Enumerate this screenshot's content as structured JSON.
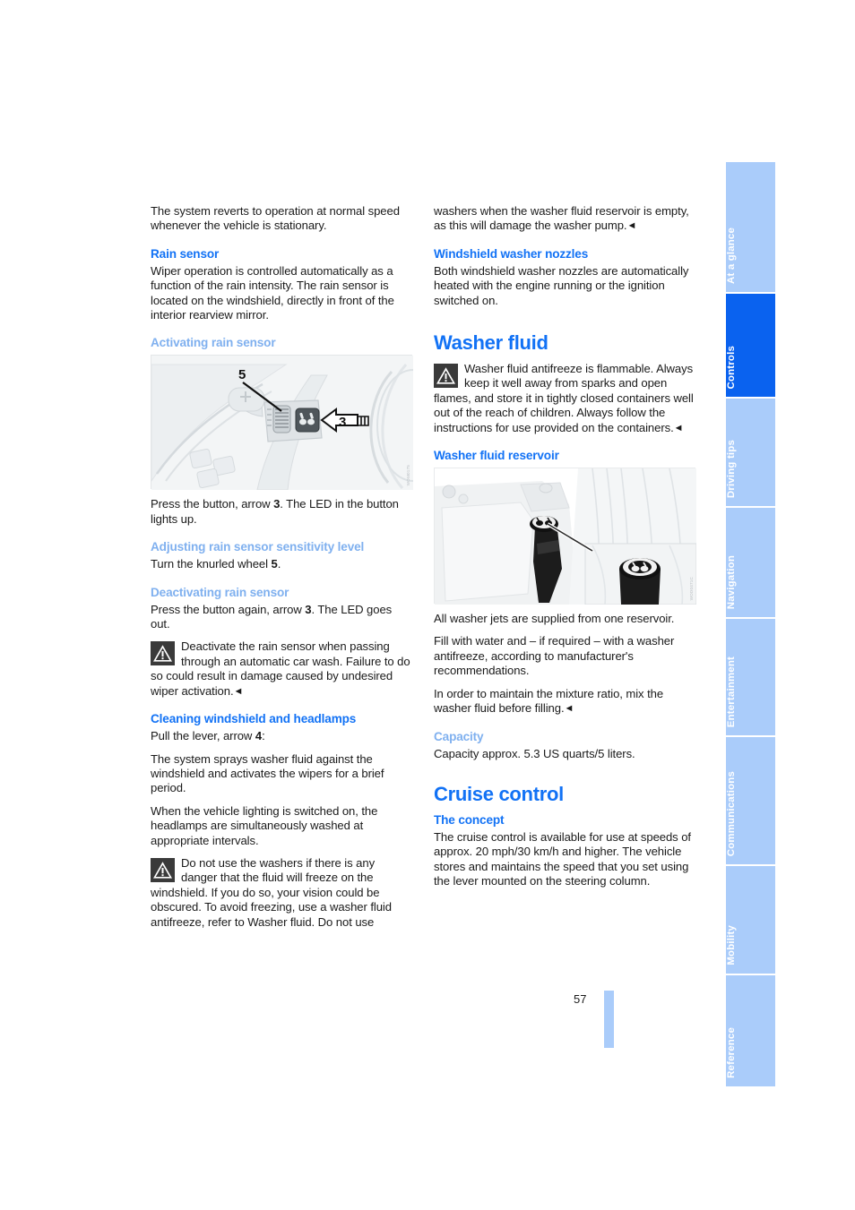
{
  "document": {
    "page_number": "57"
  },
  "left_column": {
    "intro_paragraph": "The system reverts to operation at normal speed whenever the vehicle is stationary.",
    "rain_sensor": {
      "heading": "Rain sensor",
      "paragraph": "Wiper operation is controlled automatically as a function of the rain intensity. The rain sensor is located on the windshield, directly in front of the interior rearview mirror."
    },
    "activating": {
      "heading": "Activating rain sensor",
      "figure_credit": "WOM0175",
      "figure_label_5": "5",
      "figure_label_3": "3",
      "paragraph_pre": "Press the button, arrow ",
      "paragraph_bold": "3",
      "paragraph_post": ". The LED in the button lights up."
    },
    "adjusting": {
      "heading": "Adjusting rain sensor sensitivity level",
      "paragraph_pre": "Turn the knurled wheel ",
      "paragraph_bold": "5",
      "paragraph_post": "."
    },
    "deactivating": {
      "heading": "Deactivating rain sensor",
      "paragraph_pre": "Press the button again, arrow ",
      "paragraph_bold": "3",
      "paragraph_post": ". The LED goes out.",
      "warning": "Deactivate the rain sensor when passing through an automatic car wash. Failure to do so could result in damage caused by undesired wiper activation."
    },
    "cleaning": {
      "heading": "Cleaning windshield and headlamps",
      "paragraph1_pre": "Pull the lever, arrow ",
      "paragraph1_bold": "4",
      "paragraph1_post": ":",
      "paragraph2": "The system sprays washer fluid against the windshield and activates the wipers for a brief period.",
      "paragraph3": "When the vehicle lighting is switched on, the headlamps are simultaneously washed at appropriate intervals.",
      "warning": "Do not use the washers if there is any danger that the fluid will freeze on the windshield. If you do so, your vision could be obscured. To avoid freezing, use a washer fluid antifreeze, refer to Washer fluid. Do not use"
    }
  },
  "right_column": {
    "warning_continued": "washers when the washer fluid reservoir is empty, as this will damage the washer pump.",
    "nozzles": {
      "heading": "Windshield washer nozzles",
      "paragraph": "Both windshield washer nozzles are automatically heated with the engine running or the ignition switched on."
    },
    "washer_fluid": {
      "heading": "Washer fluid",
      "warning": "Washer fluid antifreeze is flammable. Always keep it well away from sparks and open flames, and store it in tightly closed containers well out of the reach of children. Always follow the instructions for use provided on the containers."
    },
    "reservoir": {
      "heading": "Washer fluid reservoir",
      "figure_credit": "WOD0471C",
      "paragraph1": "All washer jets are supplied from one reservoir.",
      "paragraph2": "Fill with water and – if required – with a washer antifreeze, according to manufacturer's recommendations.",
      "paragraph3": "In order to maintain the mixture ratio, mix the washer fluid before filling."
    },
    "capacity": {
      "heading": "Capacity",
      "paragraph": "Capacity approx. 5.3 US quarts/5 liters."
    },
    "cruise_control": {
      "heading": "Cruise control",
      "concept_heading": "The concept",
      "paragraph": "The cruise control is available for use at speeds of approx. 20 mph/30 km/h and higher. The vehicle stores and maintains the speed that you set using the lever mounted on the steering column."
    }
  },
  "sidebar": {
    "tabs": [
      {
        "label": "At a glance",
        "active": false
      },
      {
        "label": "Controls",
        "active": true
      },
      {
        "label": "Driving tips",
        "active": false
      },
      {
        "label": "Navigation",
        "active": false
      },
      {
        "label": "Entertainment",
        "active": false
      },
      {
        "label": "Communications",
        "active": false
      },
      {
        "label": "Mobility",
        "active": false
      },
      {
        "label": "Reference",
        "active": false
      }
    ],
    "colors": {
      "inactive": "#aaccfa",
      "active": "#0a62ef"
    }
  },
  "colors": {
    "heading_primary": "#1272f5",
    "heading_secondary": "#7fb0ef",
    "page_background": "#ffffff",
    "body_text": "#1a1a1a"
  }
}
